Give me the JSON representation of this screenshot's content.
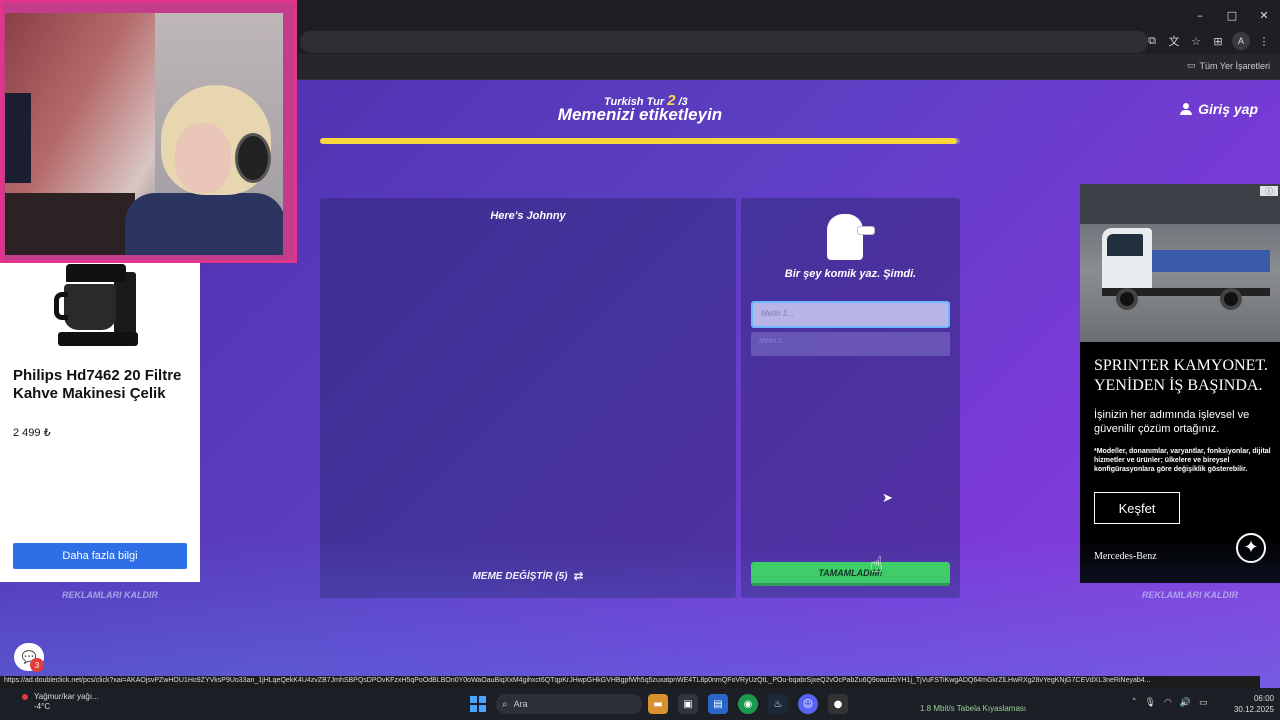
{
  "browser": {
    "all_bookmarks_label": "Tüm Yer İşaretleri",
    "window_controls": [
      "–",
      "□",
      "✕"
    ],
    "profile_initial": "A"
  },
  "game": {
    "round_prefix": "Turkish Tur",
    "round_current": "2",
    "round_total": "/3",
    "title": "Memenizi etiketleyin",
    "login_label": "Giriş yap",
    "progress": 0.995,
    "meme_title": "Here's Johnny",
    "change_meme_label": "MEME DEĞİŞTİR (5)",
    "prompt": "Bir şey komik yaz. Şimdi.",
    "caption_placeholder_1": "Metin 1...",
    "caption_placeholder_2": "Metin 2...",
    "done_label": "TAMAMLADIM!",
    "remove_ads_label": "REKLAMLARI KALDIR"
  },
  "left_ad": {
    "product_name": "Philips Hd7462 20 Filtre Kahve Makinesi Çelik",
    "price": "2 499 ₺",
    "cta": "Daha fazla bilgi"
  },
  "right_ad": {
    "heading": "SPRINTER KAMYONET. YENİDEN İŞ BAŞINDA.",
    "body": "İşinizin her adımında işlevsel ve güvenilir çözüm ortağınız.",
    "footnote": "*Modeller, donanımlar, varyantlar, fonksiyonlar, dijital hizmetler ve ürünler; ülkelere ve bireysel konfigürasyonlara göre değişiklik gösterebilir.",
    "cta": "Keşfet",
    "brand": "Mercedes-Benz"
  },
  "status_bar": {
    "url": "https://ad.doubleclick.net/pcs/click?xai=AKAOjsvPZwHOU1Ho9ZYVksP9Uo33an_1jHLqeQekK4U4zvZB7JmhSBPQsDPOvKFzxH5qPoOdBLBOn0Y0oWaOauBiqXxM4gihxct6QTqpKrJHwpGHkGVHBgpfWh5q5zuxatpnWE4TL8p0nmQFoVRyUzQtL_POu-bqabrSjxeQ2vOcPabZu6Q9oautzbYH1j_TjVuFSTiKwgADQ64mGkrZlLHwRXg28vYegKNjG7CEVdXL3neRiNeyab4..."
  },
  "taskbar": {
    "weather_line1": "Yağmur/kar yağı...",
    "weather_line2": "-4°C",
    "search_placeholder": "Ara",
    "tray_text": "1.8 Mbit/s  Tabela Kıyaslaması",
    "time": "06:00",
    "date": "30.12.2025"
  },
  "chat": {
    "badge": "3"
  },
  "colors": {
    "accent_yellow": "#f7d73a",
    "done_green": "#3cd65a",
    "cta_blue": "#2e6ee6"
  }
}
